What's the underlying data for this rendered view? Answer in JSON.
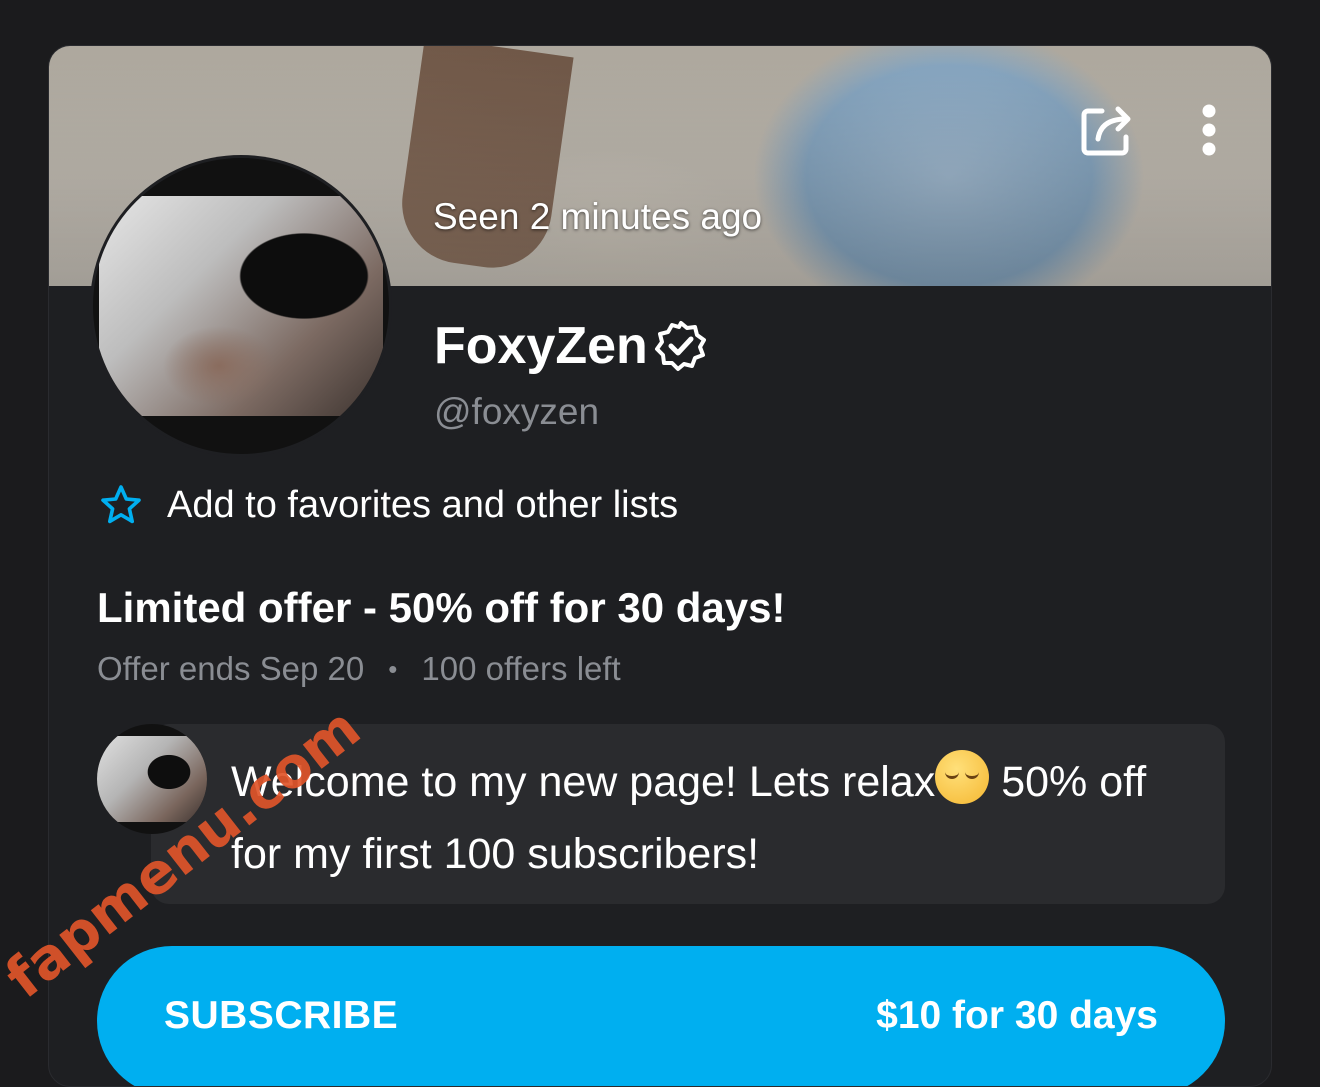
{
  "profile": {
    "seen_status": "Seen 2 minutes ago",
    "display_name": "FoxyZen",
    "handle": "@foxyzen"
  },
  "icons": {
    "share": "share-icon",
    "more": "more-vertical-icon",
    "verified": "verified-badge-icon",
    "favorite": "star-outline-icon"
  },
  "favorites": {
    "label": "Add to favorites and other lists"
  },
  "offer": {
    "title": "Limited offer - 50% off for 30 days!",
    "ends": "Offer ends Sep 20",
    "separator": "•",
    "remaining": "100 offers left"
  },
  "message": {
    "text_before_emoji": "Welcome to my new page! Lets relax",
    "emoji": "relieved-face-emoji",
    "text_after_emoji": " 50% off for my first 100 subscribers!"
  },
  "subscribe": {
    "label": "SUBSCRIBE",
    "price": "$10 for 30 days"
  },
  "watermark": {
    "text": "fapmenu.com"
  },
  "colors": {
    "background": "#1b1b1d",
    "card": "#1e1f22",
    "accent": "#00aff0",
    "muted_text": "#8a8d93",
    "bubble": "#2a2b2e",
    "watermark": "#e0552a"
  }
}
